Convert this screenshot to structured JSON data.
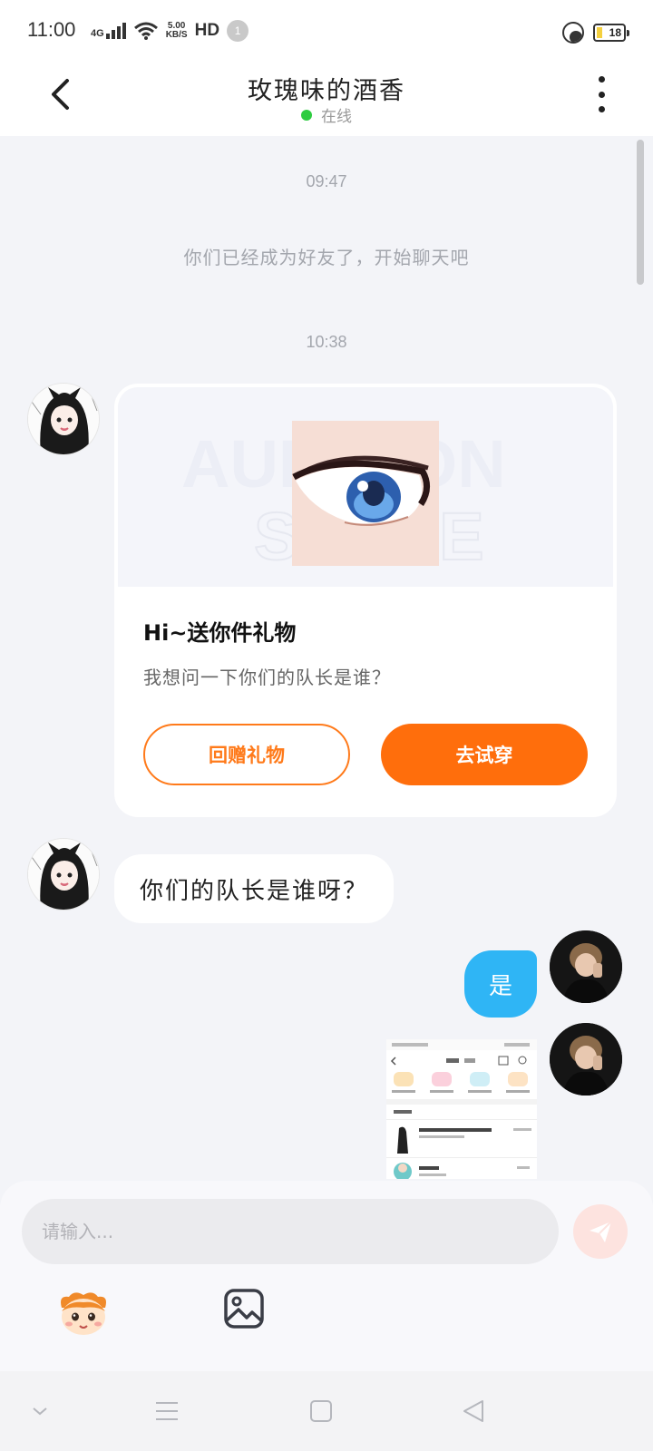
{
  "status_bar": {
    "time": "11:00",
    "network": "4G",
    "speed_value": "5.00",
    "speed_unit": "KB/S",
    "hd": "HD",
    "notification_count": "1",
    "battery": "18"
  },
  "header": {
    "title": "玫瑰味的酒香",
    "status": "在线"
  },
  "chat": {
    "timestamp_1": "09:47",
    "system_message": "你们已经成为好友了，开始聊天吧",
    "timestamp_2": "10:38",
    "gift_card": {
      "title": "Hi~送你件礼物",
      "description": "我想问一下你们的队长是谁？",
      "return_button": "回赠礼物",
      "try_button": "去试穿",
      "banner_watermark_top": "AUDITION",
      "banner_watermark_bottom": "STORE"
    },
    "received_message": "你们的队长是谁呀？",
    "sent_message": "是",
    "sent_screenshot_label": "screenshot-image"
  },
  "input": {
    "placeholder": "请输入..."
  },
  "colors": {
    "accent_orange": "#ff6e0c",
    "sent_bubble": "#2fb5f5",
    "online_green": "#2ecc40",
    "send_button_bg": "#fde3df"
  },
  "icons": {
    "back": "chevron-left-icon",
    "more": "more-vertical-icon",
    "send": "paper-plane-icon",
    "sticker": "sticker-mascot-icon",
    "image": "image-icon",
    "nav_menu": "chevron-down-icon",
    "nav_recents": "menu-icon",
    "nav_home": "square-icon",
    "nav_back": "triangle-back-icon"
  }
}
